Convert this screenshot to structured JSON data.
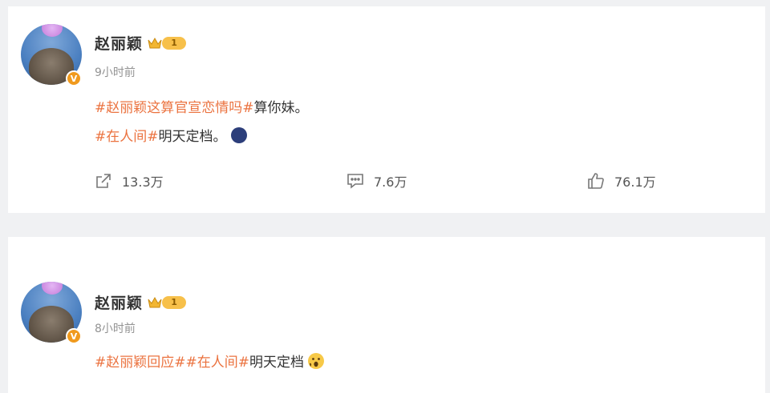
{
  "posts": [
    {
      "username": "赵丽颖",
      "level": "1",
      "verified_mark": "V",
      "time": "9小时前",
      "line1": {
        "tag": "#赵丽颖这算官宣恋情吗#",
        "text": " 算你妹。"
      },
      "line2": {
        "tag": "#在人间#",
        "text": "明天定档。",
        "emoji_icon": "moon-face-emoji"
      },
      "actions": {
        "share": {
          "icon": "share-icon",
          "count": "13.3万"
        },
        "comment": {
          "icon": "comment-icon",
          "count": "7.6万"
        },
        "like": {
          "icon": "thumbs-up-icon",
          "count": "76.1万"
        }
      }
    },
    {
      "username": "赵丽颖",
      "level": "1",
      "verified_mark": "V",
      "time": "8小时前",
      "line1": {
        "tag": "#赵丽颖回应##在人间#",
        "text": " 明天定档",
        "emoji_icon": "shocked-face-emoji"
      }
    }
  ],
  "colors": {
    "hashtag": "#eb7340",
    "verified_badge": "#f09a1e",
    "level_badge": "#f7c04a",
    "background": "#f0f1f3"
  }
}
